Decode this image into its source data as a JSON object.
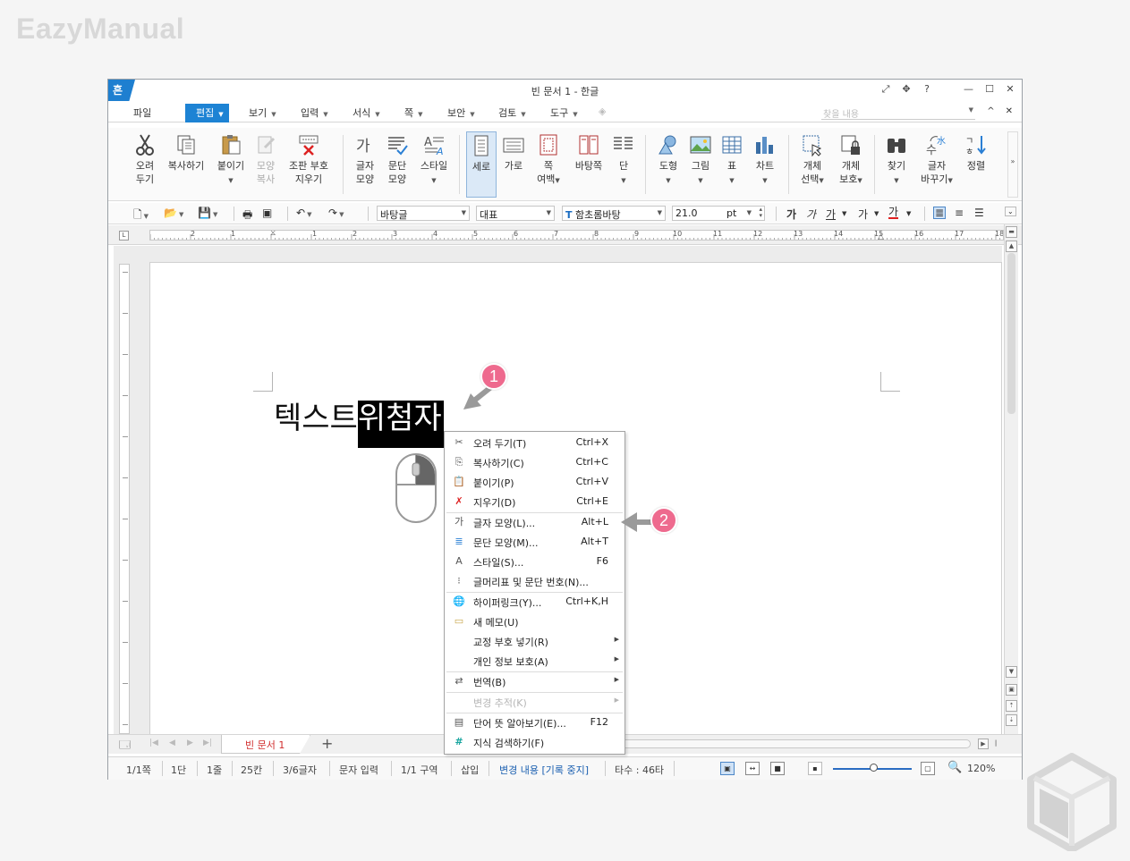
{
  "watermark": "EazyManual",
  "window": {
    "app_icon_text": "흔",
    "title": "빈 문서 1 - 한글",
    "title_controls": [
      "⤢",
      "✥",
      "?",
      "—",
      "☐",
      "✕"
    ]
  },
  "menubar": {
    "items": [
      {
        "label": "파일",
        "dropdown": false
      },
      {
        "label": "편집",
        "dropdown": true,
        "active": true
      },
      {
        "label": "보기",
        "dropdown": true
      },
      {
        "label": "입력",
        "dropdown": true
      },
      {
        "label": "서식",
        "dropdown": true
      },
      {
        "label": "쪽",
        "dropdown": true
      },
      {
        "label": "보안",
        "dropdown": true
      },
      {
        "label": "검토",
        "dropdown": true
      },
      {
        "label": "도구",
        "dropdown": true
      }
    ],
    "find_placeholder": "찾을 내용",
    "right_controls": [
      "^",
      "✕"
    ]
  },
  "ribbon": {
    "buttons": [
      {
        "line1": "오려",
        "line2": "두기",
        "icon": "scissors-icon"
      },
      {
        "line1": "복사하기",
        "line2": "",
        "icon": "copy-icon"
      },
      {
        "line1": "붙이기",
        "line2": "",
        "icon": "paste-icon",
        "dropdown": true
      },
      {
        "line1": "모양",
        "line2": "복사",
        "icon": "format-painter-icon",
        "disabled": true
      },
      {
        "line1": "조판 부호",
        "line2": "지우기",
        "icon": "clear-codes-icon"
      },
      {
        "line1": "글자",
        "line2": "모양",
        "icon": "char-shape-icon"
      },
      {
        "line1": "문단",
        "line2": "모양",
        "icon": "para-shape-icon"
      },
      {
        "line1": "스타일",
        "line2": "",
        "icon": "style-icon",
        "dropdown": true
      },
      {
        "line1": "세로",
        "line2": "",
        "icon": "portrait-icon",
        "selected": true
      },
      {
        "line1": "가로",
        "line2": "",
        "icon": "landscape-icon"
      },
      {
        "line1": "쪽",
        "line2": "여백",
        "icon": "margin-icon",
        "dropdown": true
      },
      {
        "line1": "바탕쪽",
        "line2": "",
        "icon": "master-page-icon"
      },
      {
        "line1": "단",
        "line2": "",
        "icon": "columns-icon",
        "dropdown": true
      },
      {
        "line1": "도형",
        "line2": "",
        "icon": "shape-icon",
        "dropdown": true
      },
      {
        "line1": "그림",
        "line2": "",
        "icon": "picture-icon",
        "dropdown": true
      },
      {
        "line1": "표",
        "line2": "",
        "icon": "table-icon",
        "dropdown": true
      },
      {
        "line1": "차트",
        "line2": "",
        "icon": "chart-icon",
        "dropdown": true
      },
      {
        "line1": "개체",
        "line2": "선택",
        "icon": "object-select-icon",
        "dropdown": true
      },
      {
        "line1": "개체",
        "line2": "보호",
        "icon": "object-protect-icon",
        "dropdown": true
      },
      {
        "line1": "찾기",
        "line2": "",
        "icon": "binoculars-icon",
        "dropdown": true
      },
      {
        "line1": "글자",
        "line2": "바꾸기",
        "icon": "char-convert-icon",
        "dropdown": true
      },
      {
        "line1": "정렬",
        "line2": "",
        "icon": "sort-icon"
      }
    ],
    "more": "»"
  },
  "format_toolbar": {
    "style": "바탕글",
    "lang": "대표",
    "font": "함초롬바탕",
    "font_icon": "T",
    "size": "21.0",
    "unit": "pt",
    "bold": "가",
    "italic": "가",
    "underline": "가",
    "strike": "가",
    "color": "가"
  },
  "ruler": {
    "corner": "L",
    "numbers": [
      "2",
      "1",
      "1",
      "2",
      "3",
      "4",
      "5",
      "6",
      "7",
      "8",
      "9",
      "10",
      "11",
      "12",
      "13",
      "14",
      "15",
      "16",
      "17",
      "18"
    ]
  },
  "document": {
    "text_plain": "텍스트",
    "text_selected": "위첨자"
  },
  "context_menu": [
    {
      "icon": "✂",
      "label": "오려 두기(T)",
      "shortcut": "Ctrl+X"
    },
    {
      "icon": "⎘",
      "label": "복사하기(C)",
      "shortcut": "Ctrl+C"
    },
    {
      "icon": "📋",
      "label": "붙이기(P)",
      "shortcut": "Ctrl+V"
    },
    {
      "icon": "✗",
      "label": "지우기(D)",
      "shortcut": "Ctrl+E"
    },
    {
      "icon": "가",
      "label": "글자 모양(L)...",
      "shortcut": "Alt+L"
    },
    {
      "icon": "≣",
      "label": "문단 모양(M)...",
      "shortcut": "Alt+T"
    },
    {
      "icon": "A",
      "label": "스타일(S)...",
      "shortcut": "F6"
    },
    {
      "icon": "⁝",
      "label": "글머리표 및 문단 번호(N)...",
      "shortcut": ""
    },
    {
      "icon": "🌐",
      "label": "하이퍼링크(Y)...",
      "shortcut": "Ctrl+K,H"
    },
    {
      "icon": "▭",
      "label": "새 메모(U)",
      "shortcut": ""
    },
    {
      "icon": "",
      "label": "교정 부호 넣기(R)",
      "shortcut": "",
      "submenu": true
    },
    {
      "icon": "",
      "label": "개인 정보 보호(A)",
      "shortcut": "",
      "submenu": true
    },
    {
      "icon": "⇄",
      "label": "번역(B)",
      "shortcut": "",
      "submenu": true
    },
    {
      "icon": "",
      "label": "변경 추적(K)",
      "shortcut": "",
      "submenu": true,
      "disabled": true
    },
    {
      "icon": "▤",
      "label": "단어 뜻 알아보기(E)...",
      "shortcut": "F12"
    },
    {
      "icon": "#",
      "label": "지식 검색하기(F)",
      "shortcut": ""
    }
  ],
  "annotations": {
    "badge1": "1",
    "badge2": "2"
  },
  "tabbar": {
    "nav": [
      "|◀",
      "◀",
      "▶",
      "▶|"
    ],
    "doc_tab": "빈 문서 1",
    "add": "+"
  },
  "statusbar": {
    "page": "1/1쪽",
    "column": "1단",
    "line": "1줄",
    "col": "25칸",
    "chars": "3/6글자",
    "mode": "문자 입력",
    "section": "1/1 구역",
    "insert": "삽입",
    "track": "변경 내용 [기록 중지]",
    "strokes": "타수 : 46타",
    "zoom": "120%"
  },
  "colors": {
    "accent": "#1d83d4",
    "badge": "#ee6a8e",
    "tab_text": "#d02b2b"
  }
}
